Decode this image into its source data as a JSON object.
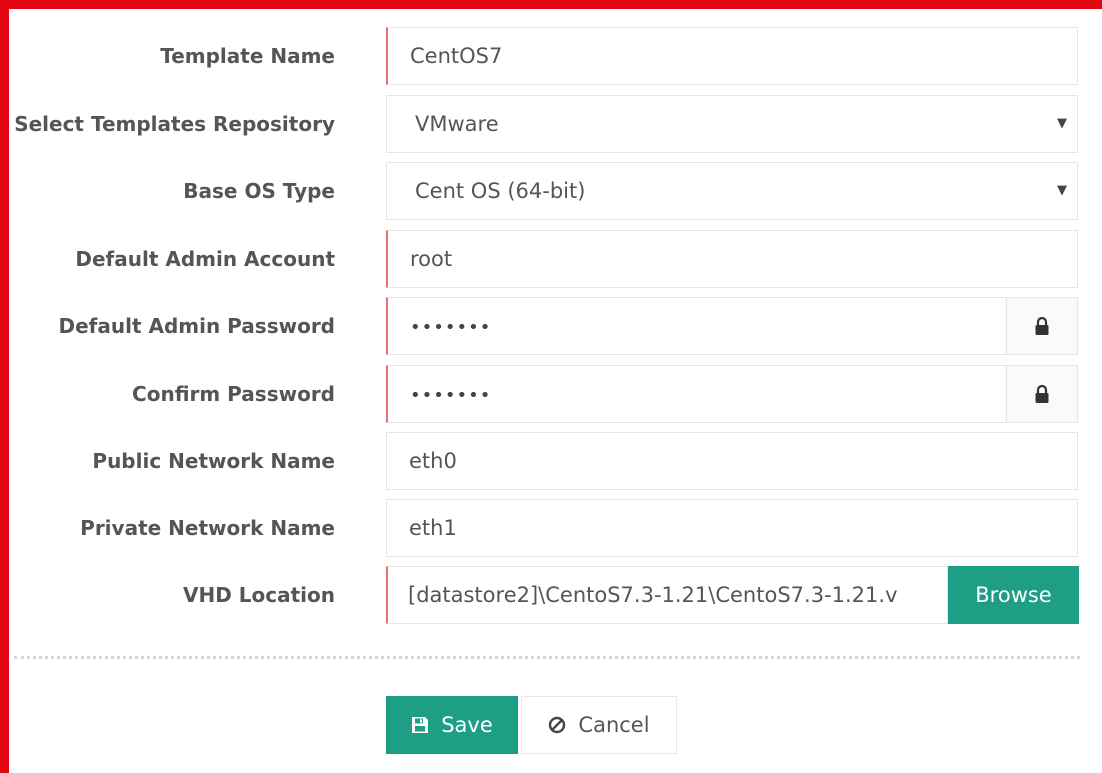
{
  "form": {
    "template_name": {
      "label": "Template Name",
      "value": "CentOS7"
    },
    "templates_repository": {
      "label": "Select Templates Repository",
      "value": "VMware"
    },
    "base_os_type": {
      "label": "Base OS Type",
      "value": "Cent OS (64-bit)"
    },
    "default_admin_account": {
      "label": "Default Admin Account",
      "value": "root"
    },
    "default_admin_password": {
      "label": "Default Admin Password",
      "value": "•••••••"
    },
    "confirm_password": {
      "label": "Confirm Password",
      "value": "•••••••"
    },
    "public_network_name": {
      "label": "Public Network Name",
      "value": "eth0"
    },
    "private_network_name": {
      "label": "Private Network Name",
      "value": "eth1"
    },
    "vhd_location": {
      "label": "VHD Location",
      "value": "[datastore2]\\CentoS7.3-1.21\\CentoS7.3-1.21.v",
      "browse_label": "Browse"
    }
  },
  "actions": {
    "save_label": "Save",
    "cancel_label": "Cancel"
  },
  "icons": {
    "select_caret": "chevron-down-icon",
    "password_lock": "lock-icon",
    "save": "floppy-disk-icon",
    "cancel": "ban-icon"
  },
  "colors": {
    "frame": "#e30613",
    "primary": "#1e9e84",
    "required_marker": "#e57373"
  }
}
